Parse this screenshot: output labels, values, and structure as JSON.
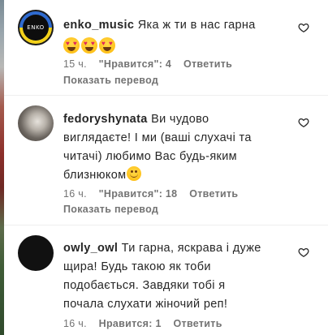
{
  "comments": [
    {
      "username": "enko_music",
      "avatar_text": "ENKO",
      "text": "Яка ж ти в нас гарна",
      "emoji_count": 3,
      "time": "15 ч.",
      "likes": "\"Нравится\": 4",
      "reply": "Ответить",
      "translate": "Показать перевод"
    },
    {
      "username": "fedoryshynata",
      "text_line1": "Ви чудово",
      "text_line2": "виглядаєте! І ми (ваші слухачі та",
      "text_line3": "читачі) любимо Вас будь-яким",
      "text_line4": "близнюком",
      "time": "16 ч.",
      "likes": "\"Нравится\": 18",
      "reply": "Ответить",
      "translate": "Показать перевод"
    },
    {
      "username": "owly_owl",
      "text_line1": "Ти гарна, яскрава і дуже",
      "text_line2": "щира! Будь такою як тоби",
      "text_line3": "подобається. Завдяки тобі я",
      "text_line4": "почала слухати жіночий реп!",
      "time": "16 ч.",
      "likes": "Нравится: 1",
      "reply": "Ответить"
    }
  ],
  "icons": {
    "like": "heart-outline-icon",
    "smile_emoji": "smiling-face-icon",
    "heart_eyes_emoji": "heart-eyes-face-icon"
  },
  "colors": {
    "text": "#262626",
    "secondary": "#737373"
  }
}
